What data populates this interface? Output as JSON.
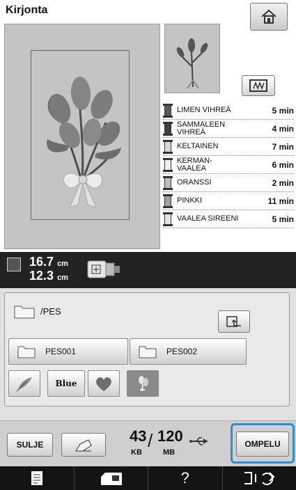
{
  "header": {
    "title": "Kirjonta"
  },
  "threads": [
    {
      "name": "LIMEN VIHREÄ",
      "time": "5 min",
      "color": "#5b5b5b"
    },
    {
      "name": "SAMMALEEN\nVIHREÄ",
      "time": "4 min",
      "color": "#3f3f3f"
    },
    {
      "name": "KELTAINEN",
      "time": "7 min",
      "color": "#d8d8d8"
    },
    {
      "name": "KERMAN-\nVAALEA",
      "time": "6 min",
      "color": "#f0f0f0"
    },
    {
      "name": "ORANSSI",
      "time": "2 min",
      "color": "#bdbdbd"
    },
    {
      "name": "PINKKI",
      "time": "11 min",
      "color": "#a0a0a0"
    },
    {
      "name": "VAALEA SIREENI",
      "time": "5 min",
      "color": "#e4e4e4"
    }
  ],
  "size": {
    "height_value": "16.7",
    "height_unit": "cm",
    "width_value": "12.3",
    "width_unit": "cm"
  },
  "browser": {
    "path": "/PES",
    "folders": [
      "PES001",
      "PES002"
    ],
    "files": [
      {
        "icon": "embroidery-leaf-thumb"
      },
      {
        "label": "Blue"
      },
      {
        "icon": "embroidery-heart-thumb"
      },
      {
        "icon": "embroidery-flower-thumb",
        "selected": true
      }
    ]
  },
  "commands": {
    "close_label": "SULJE",
    "memory_kb": "43",
    "memory_kb_unit": "KB",
    "memory_mb": "120",
    "memory_mb_unit": "MB",
    "sew_label": "OMPELU"
  },
  "footer": {
    "help_label": "?"
  },
  "colors": {
    "accent": "#2a8fd6",
    "panel": "#c4c4c4",
    "dark_bar": "#232323"
  }
}
